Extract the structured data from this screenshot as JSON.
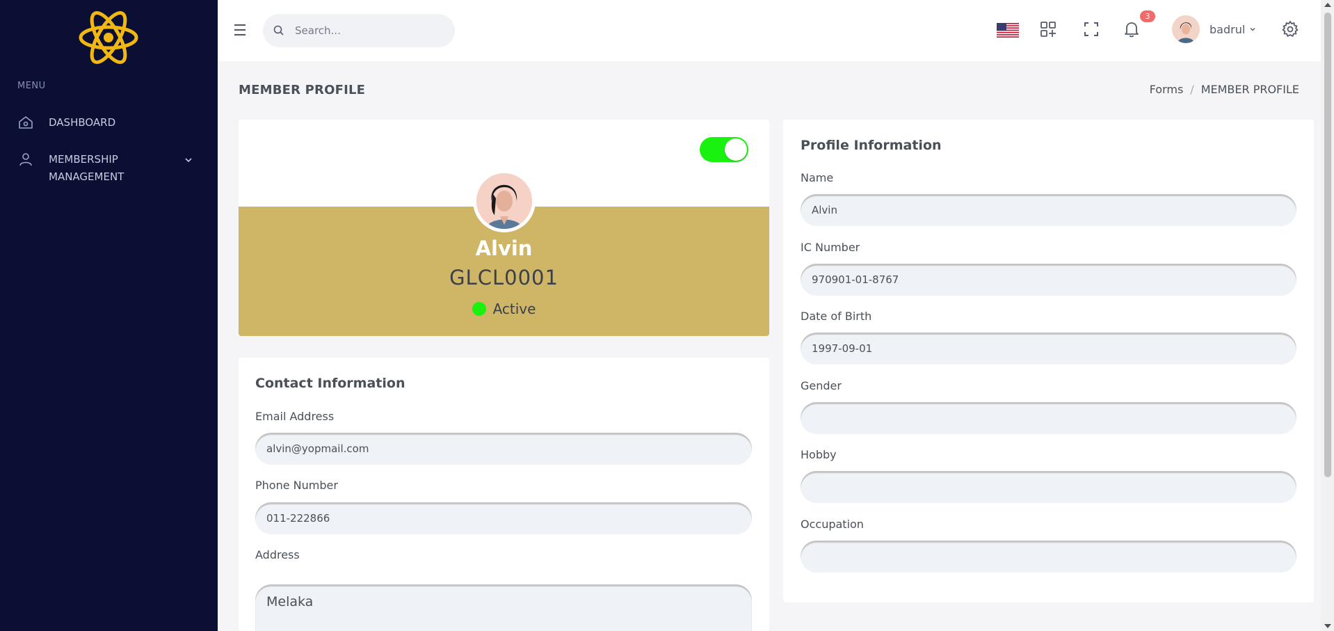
{
  "colors": {
    "sidebar_bg": "#0a0f33",
    "logo": "#f1b813",
    "profile_band": "#cfb566",
    "status_active": "#19f20e",
    "badge": "#f46a6a"
  },
  "sidebar": {
    "menu_title": "MENU",
    "items": [
      {
        "label": "DASHBOARD",
        "icon": "home-icon"
      },
      {
        "label": "MEMBERSHIP MANAGEMENT",
        "icon": "user-icon"
      }
    ]
  },
  "topbar": {
    "search_placeholder": "Search...",
    "notification_count": "3",
    "username": "badrul"
  },
  "page": {
    "title": "MEMBER PROFILE",
    "breadcrumb": [
      "Forms",
      "MEMBER PROFILE"
    ]
  },
  "profile": {
    "name": "Alvin",
    "member_id": "GLCL0001",
    "status": "Active",
    "toggle_on": true
  },
  "contact": {
    "title": "Contact Information",
    "email_label": "Email Address",
    "email_value": "alvin@yopmail.com",
    "phone_label": "Phone Number",
    "phone_value": "011-222866",
    "address_label": "Address",
    "address_value": "Melaka"
  },
  "info": {
    "title": "Profile Information",
    "name_label": "Name",
    "name_value": "Alvin",
    "ic_label": "IC Number",
    "ic_value": "970901-01-8767",
    "dob_label": "Date of Birth",
    "dob_value": "1997-09-01",
    "gender_label": "Gender",
    "gender_value": "",
    "hobby_label": "Hobby",
    "hobby_value": "",
    "occupation_label": "Occupation",
    "occupation_value": ""
  }
}
